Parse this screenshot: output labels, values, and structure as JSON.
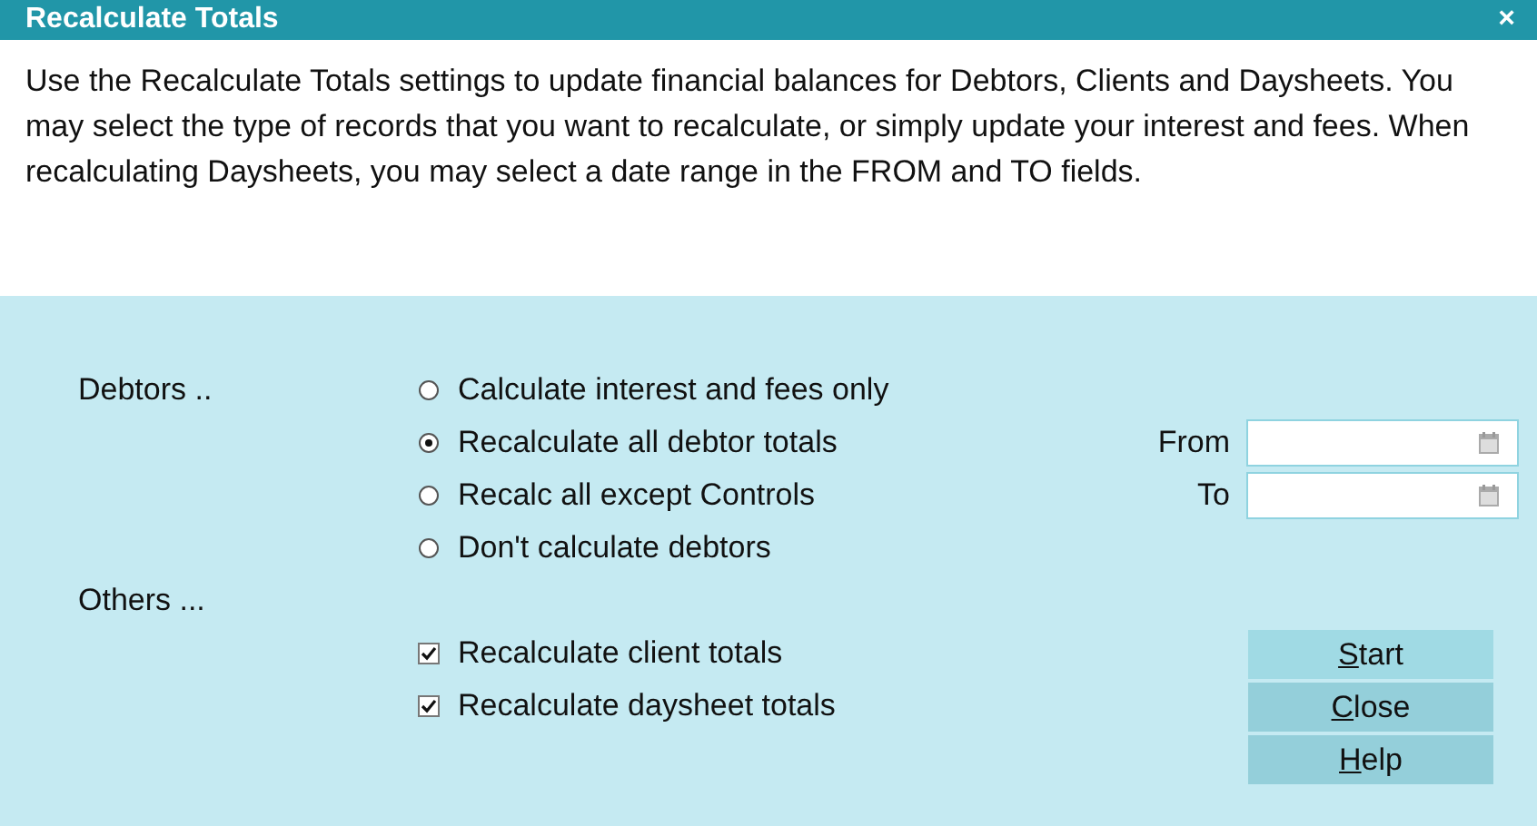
{
  "window": {
    "title": "Recalculate Totals",
    "close": "×"
  },
  "description": "Use the Recalculate Totals settings to update financial balances for Debtors, Clients and Daysheets. You may select the type of records that you want to recalculate, or simply update your interest and fees. When recalculating Daysheets, you may select a date range in the FROM and TO fields.",
  "debtors": {
    "label": "Debtors ..",
    "options": [
      {
        "label": "Calculate interest and fees only",
        "selected": false
      },
      {
        "label": "Recalculate all debtor totals",
        "selected": true
      },
      {
        "label": "Recalc all except Controls",
        "selected": false
      },
      {
        "label": "Don't calculate debtors",
        "selected": false
      }
    ]
  },
  "date_range": [
    {
      "label": "From"
    },
    {
      "label": "To"
    }
  ],
  "others": {
    "label": "Others ...",
    "options": [
      {
        "label": "Recalculate client totals",
        "checked": true
      },
      {
        "label": "Recalculate daysheet totals",
        "checked": true
      }
    ]
  },
  "buttons": [
    {
      "mnemonic": "S",
      "rest": "tart",
      "default": true
    },
    {
      "mnemonic": "C",
      "rest": "lose",
      "default": false
    },
    {
      "mnemonic": "H",
      "rest": "elp",
      "default": false
    }
  ]
}
